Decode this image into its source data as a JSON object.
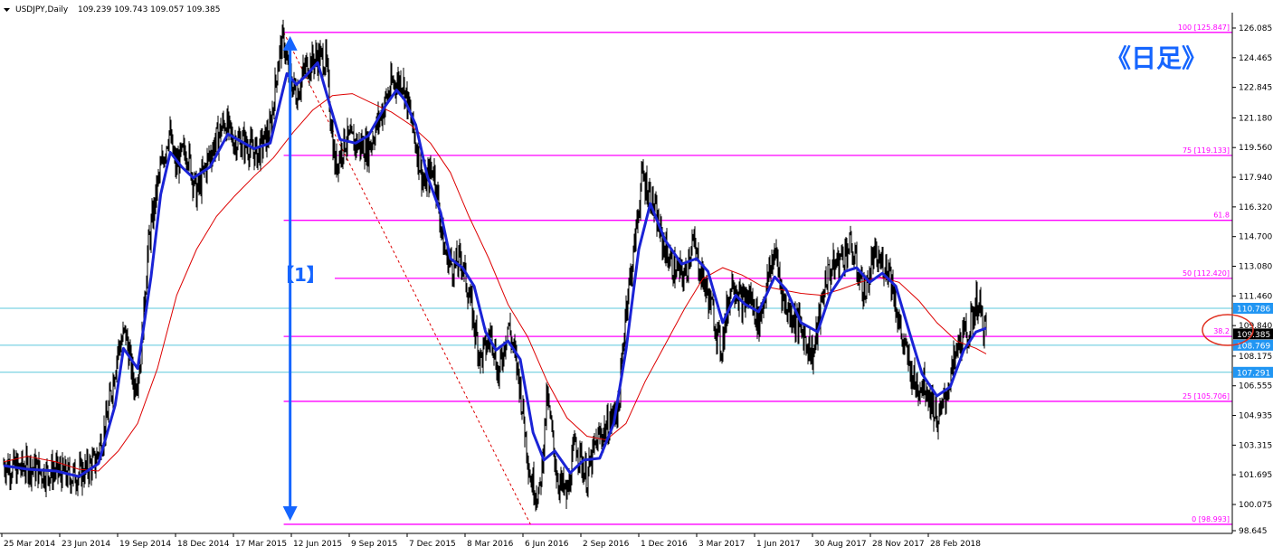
{
  "header": {
    "symbol": "USDJPY,Daily",
    "ohlc": "109.239 109.743 109.057 109.385"
  },
  "annotations": {
    "timeframe_label": "《日足》",
    "wave_label": "【1】"
  },
  "colors": {
    "fib_line": "#ff00ff",
    "sr_line": "#5bc8dc",
    "price_tag_bg": "#2196f3",
    "current_price_bg": "#000000",
    "candles": "#000000",
    "ema_fast": "#1a23d6",
    "ema_slow": "#dd0000",
    "label_blue": "#1565ff",
    "circle": "#e03020",
    "axis": "#000000"
  },
  "chart_data": {
    "type": "line",
    "title": "USDJPY,Daily",
    "ylim": [
      98.645,
      126.085
    ],
    "y_ticks": [
      "126.085",
      "124.465",
      "122.845",
      "121.180",
      "119.560",
      "117.940",
      "116.320",
      "114.700",
      "113.080",
      "111.460",
      "109.840",
      "108.175",
      "106.555",
      "104.935",
      "103.315",
      "101.695",
      "100.075",
      "98.645"
    ],
    "x_ticks": [
      "25 Mar 2014",
      "23 Jun 2014",
      "19 Sep 2014",
      "18 Dec 2014",
      "17 Mar 2015",
      "12 Jun 2015",
      "9 Sep 2015",
      "7 Dec 2015",
      "8 Mar 2016",
      "6 Jun 2016",
      "2 Sep 2016",
      "1 Dec 2016",
      "3 Mar 2017",
      "1 Jun 2017",
      "30 Aug 2017",
      "28 Nov 2017",
      "28 Feb 2018"
    ],
    "x_range": [
      "2014-03-25",
      "2018-06-05"
    ],
    "fibonacci": {
      "levels": [
        {
          "label": "100 [125.847]",
          "value": 125.847
        },
        {
          "label": "75 [119.133]",
          "value": 119.133
        },
        {
          "label": "61.8",
          "value": 115.589
        },
        {
          "label": "50 [112.420]",
          "value": 112.42
        },
        {
          "label": "38.2",
          "value": 109.251
        },
        {
          "label": "25 [105.706]",
          "value": 105.706
        },
        {
          "label": "0 [98.993]",
          "value": 98.993
        }
      ],
      "anchor_high": {
        "date": "2015-06-05",
        "value": 125.847
      },
      "anchor_low": {
        "date": "2016-06-24",
        "value": 98.993
      }
    },
    "horizontal_lines": [
      {
        "label": "110.786",
        "value": 110.786
      },
      {
        "label": "108.769",
        "value": 108.769
      },
      {
        "label": "107.291",
        "value": 107.291
      }
    ],
    "current_price": {
      "label": "109.385",
      "value": 109.385
    },
    "wave_arrow": {
      "date": "2015-06-15",
      "from": 98.993,
      "to": 125.847
    },
    "series": [
      {
        "id": "price",
        "style": "candles",
        "points": [
          [
            "2014-03-25",
            102.3
          ],
          [
            "2014-04-15",
            102.0
          ],
          [
            "2014-05-05",
            102.2
          ],
          [
            "2014-05-25",
            101.8
          ],
          [
            "2014-06-15",
            101.9
          ],
          [
            "2014-07-05",
            101.6
          ],
          [
            "2014-07-25",
            101.8
          ],
          [
            "2014-08-15",
            102.4
          ],
          [
            "2014-09-01",
            104.5
          ],
          [
            "2014-09-19",
            108.5
          ],
          [
            "2014-10-01",
            109.5
          ],
          [
            "2014-10-15",
            106.5
          ],
          [
            "2014-10-25",
            108.0
          ],
          [
            "2014-11-05",
            114.0
          ],
          [
            "2014-11-20",
            117.5
          ],
          [
            "2014-12-08",
            120.5
          ],
          [
            "2014-12-18",
            118.5
          ],
          [
            "2015-01-05",
            119.5
          ],
          [
            "2015-01-20",
            117.0
          ],
          [
            "2015-02-10",
            119.2
          ],
          [
            "2015-03-05",
            121.0
          ],
          [
            "2015-03-17",
            120.0
          ],
          [
            "2015-04-05",
            119.8
          ],
          [
            "2015-04-25",
            119.2
          ],
          [
            "2015-05-15",
            120.5
          ],
          [
            "2015-05-28",
            124.5
          ],
          [
            "2015-06-05",
            125.5
          ],
          [
            "2015-06-12",
            123.5
          ],
          [
            "2015-06-25",
            122.5
          ],
          [
            "2015-07-10",
            124.0
          ],
          [
            "2015-07-28",
            124.5
          ],
          [
            "2015-08-10",
            124.3
          ],
          [
            "2015-08-24",
            118.5
          ],
          [
            "2015-09-09",
            120.0
          ],
          [
            "2015-09-25",
            119.8
          ],
          [
            "2015-10-15",
            119.5
          ],
          [
            "2015-11-05",
            121.5
          ],
          [
            "2015-11-20",
            123.0
          ],
          [
            "2015-12-07",
            123.3
          ],
          [
            "2015-12-20",
            121.2
          ],
          [
            "2016-01-10",
            117.5
          ],
          [
            "2016-01-25",
            118.5
          ],
          [
            "2016-02-10",
            114.0
          ],
          [
            "2016-02-25",
            113.0
          ],
          [
            "2016-03-08",
            113.5
          ],
          [
            "2016-03-20",
            111.5
          ],
          [
            "2016-04-07",
            108.0
          ],
          [
            "2016-04-25",
            109.5
          ],
          [
            "2016-05-05",
            107.0
          ],
          [
            "2016-05-20",
            110.0
          ],
          [
            "2016-06-06",
            107.0
          ],
          [
            "2016-06-24",
            101.5
          ],
          [
            "2016-07-08",
            100.5
          ],
          [
            "2016-07-20",
            106.0
          ],
          [
            "2016-08-05",
            101.5
          ],
          [
            "2016-08-20",
            100.5
          ],
          [
            "2016-09-02",
            103.5
          ],
          [
            "2016-09-20",
            101.5
          ],
          [
            "2016-10-05",
            103.5
          ],
          [
            "2016-10-25",
            104.5
          ],
          [
            "2016-11-09",
            105.5
          ],
          [
            "2016-11-20",
            111.0
          ],
          [
            "2016-12-01",
            113.5
          ],
          [
            "2016-12-15",
            118.0
          ],
          [
            "2016-12-28",
            117.0
          ],
          [
            "2017-01-15",
            114.5
          ],
          [
            "2017-02-01",
            113.0
          ],
          [
            "2017-02-20",
            112.5
          ],
          [
            "2017-03-03",
            114.5
          ],
          [
            "2017-03-15",
            113.0
          ],
          [
            "2017-04-05",
            110.5
          ],
          [
            "2017-04-17",
            108.5
          ],
          [
            "2017-05-05",
            112.5
          ],
          [
            "2017-05-20",
            111.0
          ],
          [
            "2017-06-01",
            111.5
          ],
          [
            "2017-06-15",
            110.0
          ],
          [
            "2017-07-10",
            114.0
          ],
          [
            "2017-07-25",
            111.0
          ],
          [
            "2017-08-15",
            110.0
          ],
          [
            "2017-09-08",
            108.2
          ],
          [
            "2017-09-28",
            112.5
          ],
          [
            "2017-10-20",
            113.5
          ],
          [
            "2017-11-05",
            114.2
          ],
          [
            "2017-11-28",
            111.5
          ],
          [
            "2017-12-10",
            113.5
          ],
          [
            "2018-01-05",
            113.0
          ],
          [
            "2018-01-25",
            109.0
          ],
          [
            "2018-02-15",
            106.5
          ],
          [
            "2018-02-28",
            106.8
          ],
          [
            "2018-03-23",
            104.6
          ],
          [
            "2018-04-10",
            107.0
          ],
          [
            "2018-04-25",
            109.0
          ],
          [
            "2018-05-10",
            109.5
          ],
          [
            "2018-05-21",
            111.3
          ],
          [
            "2018-06-05",
            109.4
          ]
        ]
      },
      {
        "id": "ema_fast",
        "style": "line",
        "points": [
          [
            "2014-03-25",
            102.2
          ],
          [
            "2014-05-01",
            102.0
          ],
          [
            "2014-06-15",
            101.9
          ],
          [
            "2014-07-20",
            101.6
          ],
          [
            "2014-08-20",
            102.3
          ],
          [
            "2014-09-15",
            105.5
          ],
          [
            "2014-09-28",
            108.6
          ],
          [
            "2014-10-20",
            107.5
          ],
          [
            "2014-11-10",
            112.5
          ],
          [
            "2014-11-25",
            117.0
          ],
          [
            "2014-12-10",
            119.3
          ],
          [
            "2014-12-28",
            118.5
          ],
          [
            "2015-01-15",
            117.9
          ],
          [
            "2015-02-10",
            118.5
          ],
          [
            "2015-03-10",
            120.3
          ],
          [
            "2015-03-25",
            120.0
          ],
          [
            "2015-04-20",
            119.5
          ],
          [
            "2015-05-15",
            119.8
          ],
          [
            "2015-05-30",
            122.0
          ],
          [
            "2015-06-10",
            123.6
          ],
          [
            "2015-06-25",
            123.0
          ],
          [
            "2015-07-10",
            123.5
          ],
          [
            "2015-07-28",
            124.2
          ],
          [
            "2015-08-15",
            122.0
          ],
          [
            "2015-09-01",
            120.0
          ],
          [
            "2015-09-25",
            119.8
          ],
          [
            "2015-10-15",
            120.2
          ],
          [
            "2015-11-10",
            121.8
          ],
          [
            "2015-11-28",
            122.7
          ],
          [
            "2015-12-10",
            122.2
          ],
          [
            "2015-12-28",
            120.8
          ],
          [
            "2016-01-15",
            118.0
          ],
          [
            "2016-02-05",
            116.0
          ],
          [
            "2016-02-20",
            113.5
          ],
          [
            "2016-03-10",
            113.0
          ],
          [
            "2016-03-28",
            112.0
          ],
          [
            "2016-04-15",
            109.5
          ],
          [
            "2016-05-01",
            108.5
          ],
          [
            "2016-05-20",
            109.0
          ],
          [
            "2016-06-08",
            108.0
          ],
          [
            "2016-06-28",
            104.0
          ],
          [
            "2016-07-15",
            102.5
          ],
          [
            "2016-08-01",
            103.0
          ],
          [
            "2016-08-25",
            101.8
          ],
          [
            "2016-09-15",
            102.5
          ],
          [
            "2016-10-10",
            102.6
          ],
          [
            "2016-11-01",
            104.5
          ],
          [
            "2016-11-20",
            108.5
          ],
          [
            "2016-12-10",
            114.0
          ],
          [
            "2016-12-28",
            116.5
          ],
          [
            "2017-01-20",
            114.5
          ],
          [
            "2017-02-15",
            113.2
          ],
          [
            "2017-03-10",
            113.5
          ],
          [
            "2017-03-28",
            112.8
          ],
          [
            "2017-04-20",
            110.0
          ],
          [
            "2017-05-10",
            111.5
          ],
          [
            "2017-05-25",
            111.0
          ],
          [
            "2017-06-15",
            110.6
          ],
          [
            "2017-07-10",
            112.5
          ],
          [
            "2017-07-28",
            111.8
          ],
          [
            "2017-08-20",
            110.0
          ],
          [
            "2017-09-15",
            109.5
          ],
          [
            "2017-10-05",
            111.6
          ],
          [
            "2017-10-28",
            112.8
          ],
          [
            "2017-11-15",
            113.0
          ],
          [
            "2017-12-05",
            112.2
          ],
          [
            "2017-12-25",
            112.7
          ],
          [
            "2018-01-15",
            112.0
          ],
          [
            "2018-02-05",
            109.5
          ],
          [
            "2018-02-25",
            107.2
          ],
          [
            "2018-03-20",
            106.0
          ],
          [
            "2018-04-10",
            106.5
          ],
          [
            "2018-05-01",
            108.5
          ],
          [
            "2018-05-20",
            109.5
          ],
          [
            "2018-06-05",
            109.7
          ]
        ]
      },
      {
        "id": "ema_slow",
        "style": "line",
        "points": [
          [
            "2014-03-25",
            102.4
          ],
          [
            "2014-05-01",
            102.7
          ],
          [
            "2014-06-15",
            102.4
          ],
          [
            "2014-07-20",
            102.0
          ],
          [
            "2014-08-20",
            101.9
          ],
          [
            "2014-09-20",
            103.0
          ],
          [
            "2014-10-20",
            104.5
          ],
          [
            "2014-11-20",
            107.5
          ],
          [
            "2014-12-20",
            111.5
          ],
          [
            "2015-01-20",
            114.0
          ],
          [
            "2015-02-20",
            115.8
          ],
          [
            "2015-03-20",
            116.9
          ],
          [
            "2015-04-20",
            118.0
          ],
          [
            "2015-05-20",
            119.0
          ],
          [
            "2015-06-20",
            120.4
          ],
          [
            "2015-07-20",
            121.6
          ],
          [
            "2015-08-20",
            122.4
          ],
          [
            "2015-09-20",
            122.5
          ],
          [
            "2015-10-20",
            122.0
          ],
          [
            "2015-11-20",
            121.5
          ],
          [
            "2015-12-20",
            120.8
          ],
          [
            "2016-01-20",
            119.8
          ],
          [
            "2016-02-20",
            118.2
          ],
          [
            "2016-03-20",
            115.8
          ],
          [
            "2016-04-20",
            113.5
          ],
          [
            "2016-05-20",
            111.0
          ],
          [
            "2016-06-20",
            109.2
          ],
          [
            "2016-07-20",
            106.8
          ],
          [
            "2016-08-20",
            104.8
          ],
          [
            "2016-09-20",
            103.8
          ],
          [
            "2016-10-20",
            103.6
          ],
          [
            "2016-11-20",
            104.5
          ],
          [
            "2016-12-20",
            106.8
          ],
          [
            "2017-01-20",
            108.8
          ],
          [
            "2017-02-20",
            110.8
          ],
          [
            "2017-03-20",
            112.4
          ],
          [
            "2017-04-20",
            113.0
          ],
          [
            "2017-05-20",
            112.6
          ],
          [
            "2017-06-20",
            112.0
          ],
          [
            "2017-07-20",
            111.8
          ],
          [
            "2017-08-20",
            111.6
          ],
          [
            "2017-09-20",
            111.5
          ],
          [
            "2017-10-20",
            111.8
          ],
          [
            "2017-11-20",
            112.2
          ],
          [
            "2017-12-20",
            112.5
          ],
          [
            "2018-01-20",
            112.2
          ],
          [
            "2018-02-20",
            111.2
          ],
          [
            "2018-03-20",
            110.0
          ],
          [
            "2018-04-20",
            109.0
          ],
          [
            "2018-05-20",
            108.6
          ],
          [
            "2018-06-05",
            108.3
          ]
        ]
      }
    ]
  }
}
